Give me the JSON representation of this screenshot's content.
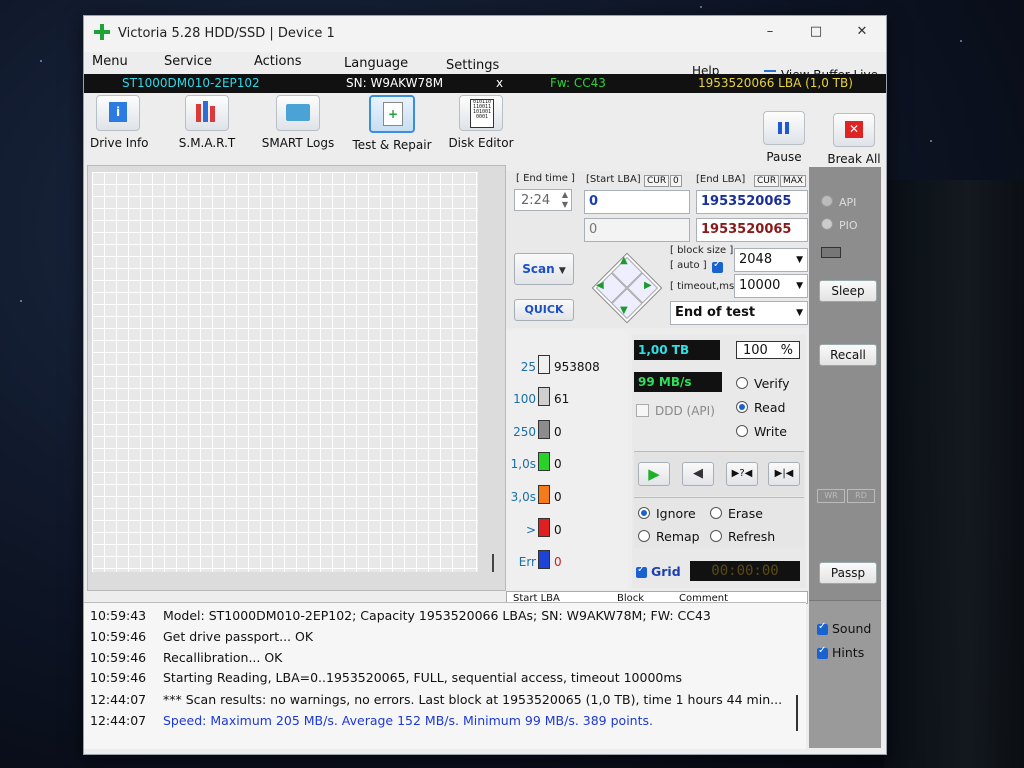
{
  "window": {
    "title": "Victoria 5.28 HDD/SSD | Device 1",
    "controls": {
      "minimize": "–",
      "maximize": "□",
      "close": "✕"
    }
  },
  "menu": {
    "items": [
      "Menu",
      "Service",
      "Actions",
      "Language",
      "Settings"
    ],
    "help": "Help",
    "view_buffer_live": "View Buffer Live"
  },
  "drive": {
    "model": "ST1000DM010-2EP102",
    "serial": "SN: W9AKW78M",
    "close": "x",
    "firmware": "Fw: CC43",
    "lba": "1953520066 LBA (1,0 TB)"
  },
  "toolbar": {
    "tools": [
      "Drive Info",
      "S.M.A.R.T",
      "SMART Logs",
      "Test & Repair",
      "Disk Editor"
    ],
    "pause": "Pause",
    "break_all": "Break All"
  },
  "scan": {
    "end_time_label": "[ End time ]",
    "end_time": "2:24",
    "start_lba_label": "[Start LBA]",
    "cur_tag": "CUR",
    "zero_tag": "0",
    "start_lba": "0",
    "start_lba_cur": "0",
    "end_lba_label": "[End LBA]",
    "max_tag": "MAX",
    "end_lba": "1953520065",
    "end_lba_cur": "1953520065",
    "scan_button": "Scan",
    "quick_button": "QUICK",
    "block_size_label": "[ block size ]",
    "auto_label": "[ auto ]",
    "block_size": "2048",
    "timeout_label": "[ timeout,ms ]",
    "timeout": "10000",
    "end_action": "End of test"
  },
  "stats": {
    "rows": [
      {
        "label": "25",
        "count": "953808",
        "color": "#f0f0f0"
      },
      {
        "label": "100",
        "count": "61",
        "color": "#cfcfcf"
      },
      {
        "label": "250",
        "count": "0",
        "color": "#8c8c8c"
      },
      {
        "label": "1,0s",
        "count": "0",
        "color": "#28d328"
      },
      {
        "label": "3,0s",
        "count": "0",
        "color": "#f57a1a"
      },
      {
        "label": ">",
        "count": "0",
        "color": "#e02020"
      },
      {
        "label": "Err",
        "count": "0",
        "color": "#1f43d6"
      }
    ],
    "size": "1,00 TB",
    "percent": "100",
    "percent_sign": "%",
    "speed": "99 MB/s",
    "ddd": "DDD (API)",
    "modes": [
      "Verify",
      "Read",
      "Write"
    ],
    "selected_mode": "Read",
    "repair_options": [
      "Ignore",
      "Erase",
      "Remap",
      "Refresh"
    ],
    "selected_repair": "Ignore",
    "grid_label": "Grid",
    "timer": "00:00:00",
    "table_headers": [
      "Start LBA",
      "Block",
      "Comment"
    ]
  },
  "side": {
    "api": "API",
    "pio": "PIO",
    "sleep": "Sleep",
    "recall": "Recall",
    "wr": "WR",
    "rd": "RD",
    "passp": "Passp",
    "sound": "Sound",
    "hints": "Hints"
  },
  "log": [
    {
      "time": "10:59:43",
      "text": "Model: ST1000DM010-2EP102; Capacity 1953520066 LBAs; SN: W9AKW78M; FW: CC43",
      "blue": false
    },
    {
      "time": "10:59:46",
      "text": "Get drive passport... OK",
      "blue": false
    },
    {
      "time": "10:59:46",
      "text": "Recallibration... OK",
      "blue": false
    },
    {
      "time": "10:59:46",
      "text": "Starting Reading, LBA=0..1953520065, FULL, sequential access, timeout 10000ms",
      "blue": false
    },
    {
      "time": "12:44:07",
      "text": "*** Scan results: no warnings, no errors. Last block at 1953520065 (1,0 TB), time 1 hours 44 min...",
      "blue": false
    },
    {
      "time": "12:44:07",
      "text": "Speed: Maximum 205 MB/s. Average 152 MB/s. Minimum 99 MB/s. 389 points.",
      "blue": true
    }
  ]
}
